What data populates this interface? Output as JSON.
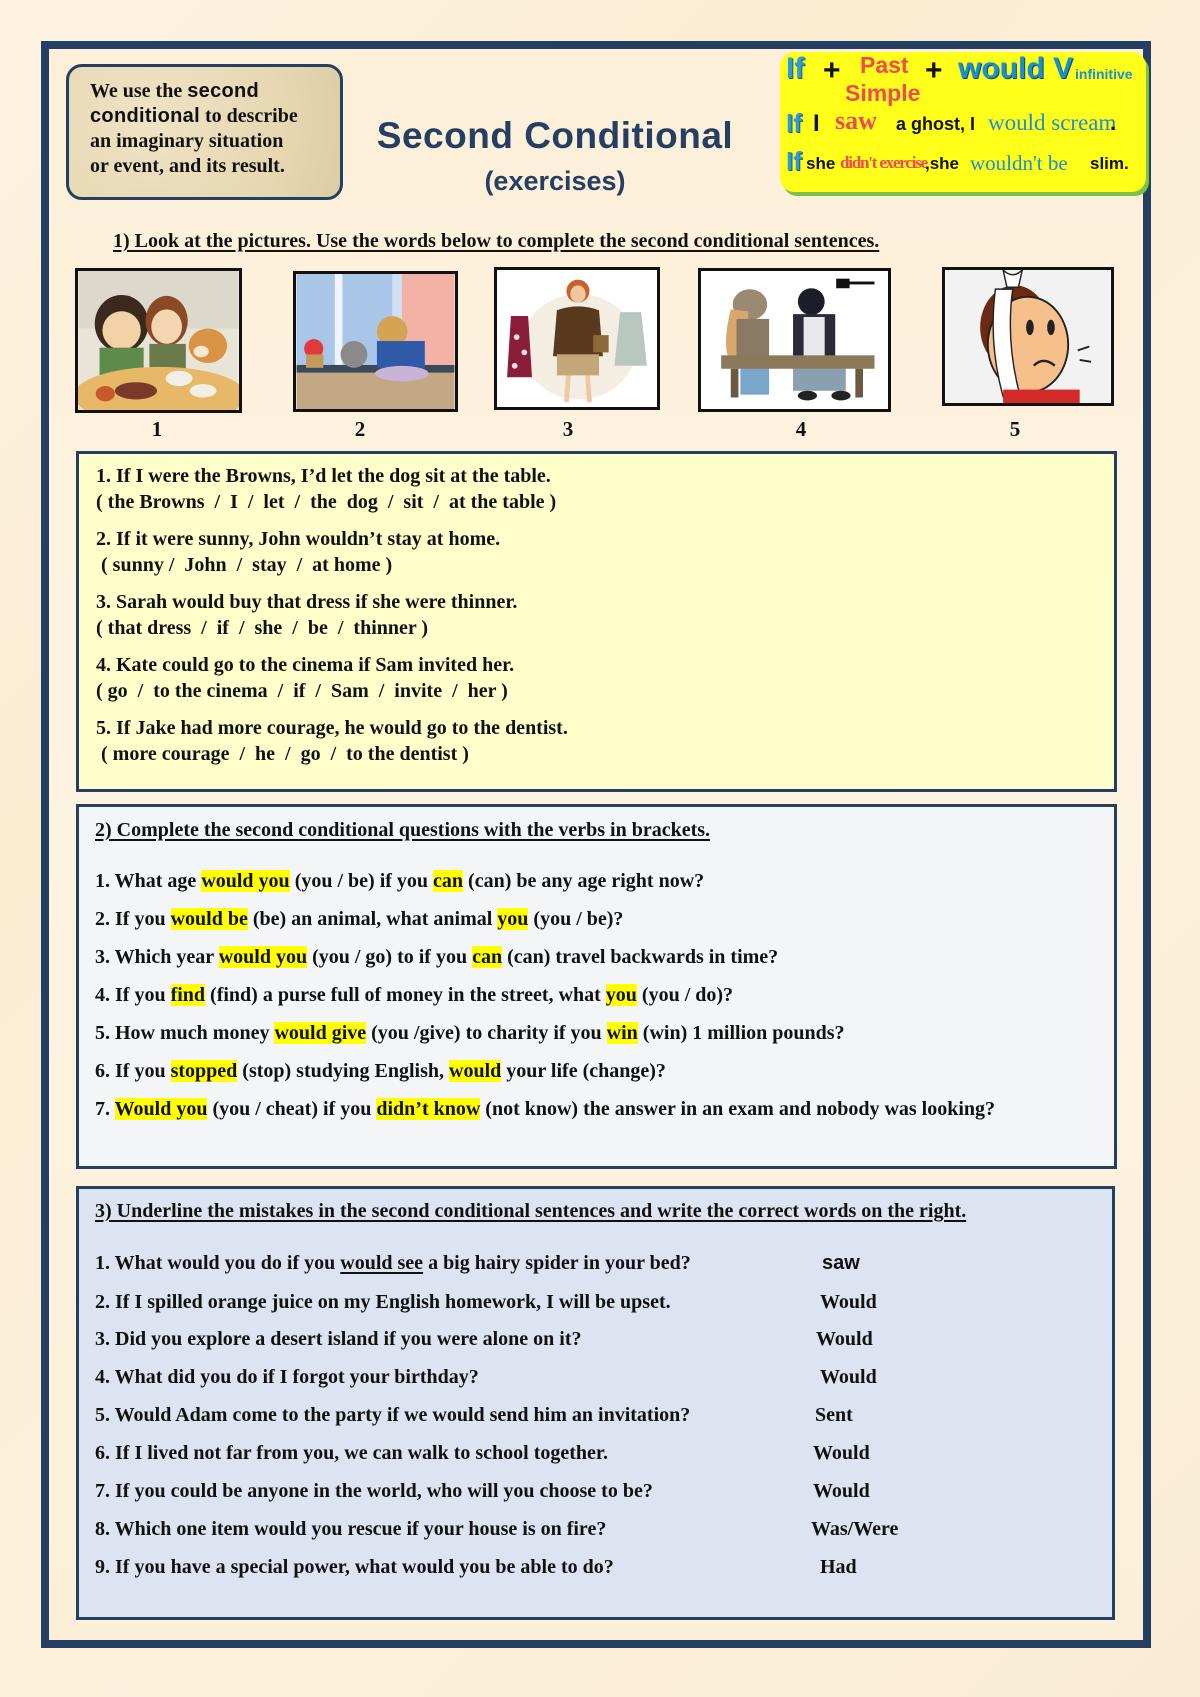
{
  "intro": {
    "part1": "We use the ",
    "bold1": "second",
    "bold2": "conditional",
    "part2": " to describe",
    "line3": "an imaginary situation",
    "line4": "or event, and its result."
  },
  "header": {
    "title": "Second Conditional",
    "subtitle": "(exercises)"
  },
  "formula_box": {
    "row1": {
      "if": "If",
      "plus1": "+",
      "past": "Past",
      "simple": "Simple",
      "plus2": "+",
      "would_v": "would V",
      "infinitive": "infinitive"
    },
    "row2": {
      "if": "If",
      "i": "I",
      "saw": "saw",
      "mid": "a ghost, I",
      "would_scream": "would scream",
      "dot": "."
    },
    "row3": {
      "if": "If",
      "she": "she",
      "didnt": "didn't exercise",
      "mid": ",she",
      "wouldnt": "wouldn't be",
      "slim": "slim."
    },
    "colors": {
      "background": "#ffff1a",
      "if": "#2e9bd6",
      "past_simple": "#f04a52",
      "would": "#1b8fd0"
    }
  },
  "exercise1": {
    "heading": "1) Look at the pictures. Use the words below to complete the second conditional sentences.",
    "pictures": [
      {
        "label": "1",
        "description": "couple and dog at dinner table"
      },
      {
        "label": "2",
        "description": "boy and cat looking out rainy window"
      },
      {
        "label": "3",
        "description": "woman holding up a dress and a jacket"
      },
      {
        "label": "4",
        "description": "girl and boy sitting on a bench"
      },
      {
        "label": "5",
        "description": "man with bandaged face and toothache"
      }
    ],
    "items": [
      {
        "sentence": "1. If I were the Browns, I’d let the dog sit at the table.",
        "words": "( the Browns  /  I  /  let  /  the  dog  /  sit  /  at the table )"
      },
      {
        "sentence": "2. If it were sunny, John wouldn’t stay at home.",
        "words": " ( sunny /  John  /  stay  /  at home )"
      },
      {
        "sentence": "3. Sarah would buy that dress if she were thinner.",
        "words": "( that dress  /  if  /  she  /  be  /  thinner )"
      },
      {
        "sentence": "4. Kate could go to the cinema if Sam invited her.",
        "words": "( go  /  to the cinema  /  if  /  Sam  /  invite  /  her )"
      },
      {
        "sentence": "5. If Jake had more courage, he would go to the dentist.",
        "words": " ( more courage  /  he  /  go  /  to the dentist )"
      }
    ]
  },
  "exercise2": {
    "heading": "2) Complete the second conditional questions with the verbs in brackets.",
    "highlight_color": "#ffff00",
    "items": [
      [
        {
          "t": "1. What age "
        },
        {
          "t": "would you",
          "hl": true
        },
        {
          "t": " (you / be) if you "
        },
        {
          "t": "can",
          "hl": true
        },
        {
          "t": " (can) be any age right now?"
        }
      ],
      [
        {
          "t": "2. If you "
        },
        {
          "t": "would be",
          "hl": true
        },
        {
          "t": " (be) an animal, what animal "
        },
        {
          "t": "you",
          "hl": true
        },
        {
          "t": " (you / be)?"
        }
      ],
      [
        {
          "t": "3. Which year "
        },
        {
          "t": "would you",
          "hl": true
        },
        {
          "t": " (you / go) to if you "
        },
        {
          "t": "can",
          "hl": true
        },
        {
          "t": " (can) travel backwards in time?"
        }
      ],
      [
        {
          "t": "4. If you "
        },
        {
          "t": "find",
          "hl": true
        },
        {
          "t": " (find) a purse full of money in the street, what "
        },
        {
          "t": "you",
          "hl": true
        },
        {
          "t": " (you / do)?"
        }
      ],
      [
        {
          "t": "5. How much money "
        },
        {
          "t": "would give",
          "hl": true
        },
        {
          "t": " (you /give) to charity if you "
        },
        {
          "t": "win",
          "hl": true
        },
        {
          "t": " (win) 1 million pounds?"
        }
      ],
      [
        {
          "t": "6. If you "
        },
        {
          "t": "stopped",
          "hl": true
        },
        {
          "t": " (stop) studying English, "
        },
        {
          "t": "would",
          "hl": true
        },
        {
          "t": " your life (change)?"
        }
      ],
      [
        {
          "t": "7. "
        },
        {
          "t": "Would you",
          "hl": true
        },
        {
          "t": " (you / cheat) if you "
        },
        {
          "t": "didn’t know",
          "hl": true
        },
        {
          "t": " (not know) the answer in an exam and nobody was looking?"
        }
      ]
    ]
  },
  "exercise3": {
    "heading": "3) Underline the mistakes in the second conditional sentences and write the correct words on the right.",
    "items": [
      {
        "parts": [
          {
            "t": "1. What would you do if you "
          },
          {
            "t": "would see",
            "ul": true
          },
          {
            "t": " a big hairy spider in your bed?"
          }
        ],
        "answer": "saw"
      },
      {
        "parts": [
          {
            "t": "2. If I spilled orange juice on my English homework, I will be upset."
          }
        ],
        "answer": "Would"
      },
      {
        "parts": [
          {
            "t": "3. Did you explore a desert island if you were alone on it?"
          }
        ],
        "answer": "Would"
      },
      {
        "parts": [
          {
            "t": "4. What did you do if I forgot your birthday?"
          }
        ],
        "answer": "Would"
      },
      {
        "parts": [
          {
            "t": "5. Would Adam come to the party if we would send him an invitation?"
          }
        ],
        "answer": "Sent"
      },
      {
        "parts": [
          {
            "t": "6. If I lived not far from you, we can walk to school together."
          }
        ],
        "answer": "Would"
      },
      {
        "parts": [
          {
            "t": "7. If you could be anyone in the world, who will you choose to be?"
          }
        ],
        "answer": "Would"
      },
      {
        "parts": [
          {
            "t": "8. Which one item would you rescue if your house is on fire?"
          }
        ],
        "answer": "Was/Were"
      },
      {
        "parts": [
          {
            "t": "9. If you have a special power, what would you be able to do?"
          }
        ],
        "answer": "Had"
      }
    ]
  }
}
